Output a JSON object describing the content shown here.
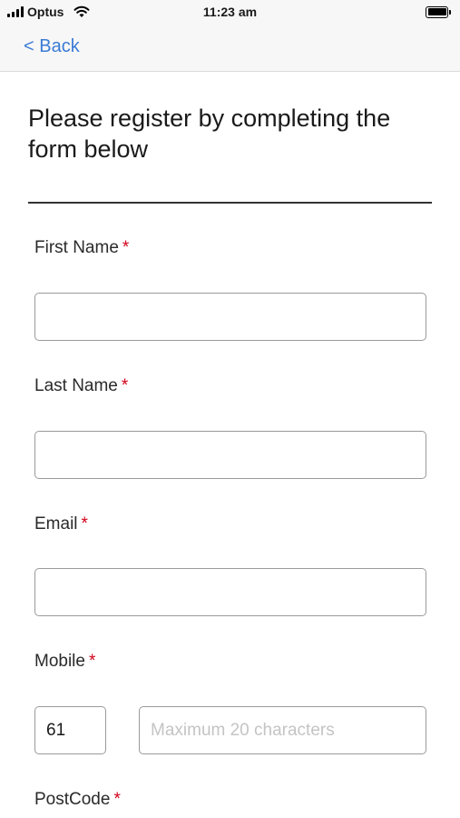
{
  "status_bar": {
    "carrier": "Optus",
    "time": "11:23 am"
  },
  "nav": {
    "back_label": "< Back"
  },
  "page_title": "Please register by completing the form below",
  "required_marker": "*",
  "form": {
    "first_name": {
      "label": "First Name",
      "value": ""
    },
    "last_name": {
      "label": "Last Name",
      "value": ""
    },
    "email": {
      "label": "Email",
      "value": ""
    },
    "mobile": {
      "label": "Mobile",
      "country_code": "61",
      "placeholder": "Maximum 20 characters",
      "value": ""
    },
    "postcode": {
      "label": "PostCode"
    }
  },
  "colors": {
    "link": "#3a7bd5",
    "required": "#d0021b",
    "border": "#9a9a9a"
  }
}
